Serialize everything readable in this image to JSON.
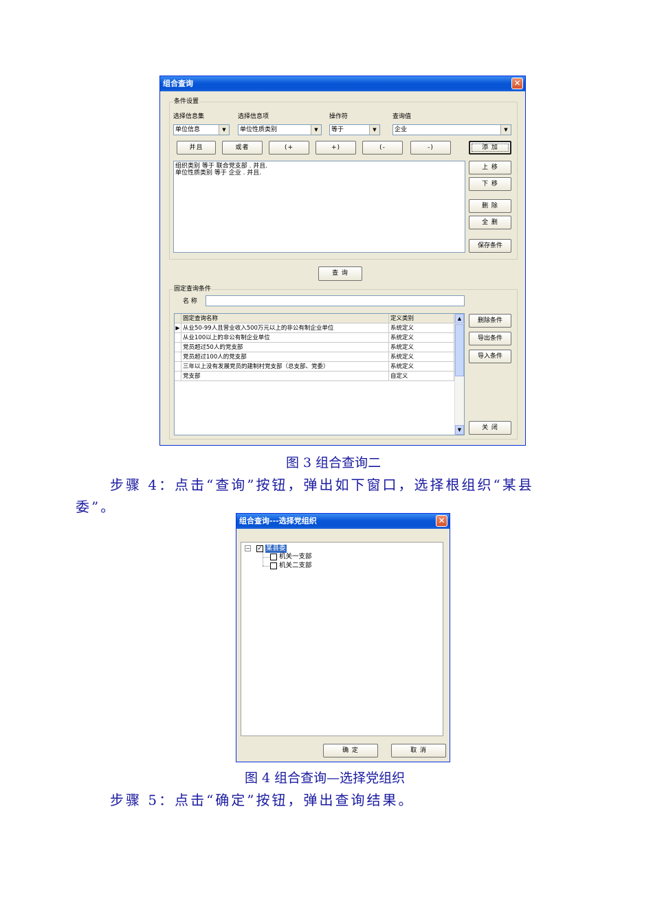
{
  "dialog1": {
    "title": "组合查询",
    "conditions_group": "条件设置",
    "col_labels": [
      "选择信息集",
      "选择信息项",
      "操作符",
      "查询值"
    ],
    "info_set": "单位信息",
    "info_item": "单位性质类别",
    "operator": "等于",
    "query_value": "企业",
    "logic_buttons": [
      "并且",
      "或者",
      "(+",
      "+)",
      "(-",
      "-)"
    ],
    "add_button": "添 加",
    "condition_lines": [
      "组织类别 等于 联合党支部 . 并且.",
      "单位性质类别 等于 企业 . 并且."
    ],
    "side_buttons": [
      "上 移",
      "下 移",
      "删 除",
      "全 删",
      "保存条件"
    ],
    "query_button": "查 询",
    "fixed_group": "固定查询条件",
    "name_label": "名 称",
    "name_value": "",
    "grid_headers": [
      "固定查询名称",
      "定义类别"
    ],
    "grid_rows": [
      [
        "从业50-99人且营业收入500万元以上的非公有制企业单位",
        "系统定义"
      ],
      [
        "从业100以上的非公有制企业单位",
        "系统定义"
      ],
      [
        "党员超过50人的党支部",
        "系统定义"
      ],
      [
        "党员超过100人的党支部",
        "系统定义"
      ],
      [
        "三年以上没有发展党员的建制村党支部（总支部、党委）",
        "系统定义"
      ],
      [
        "党支部",
        "自定义"
      ]
    ],
    "fixed_buttons": [
      "删除条件",
      "导出条件",
      "导入条件"
    ],
    "close_button": "关 闭"
  },
  "caption3": "图 3  组合查询二",
  "step4_line1": "步骤 4：点击“查询”按钮，弹出如下窗口，选择根组织“某县",
  "step4_line2": "委”。",
  "dialog2": {
    "title": "组合查询---选择党组织",
    "tree_root": "某县委",
    "tree_children": [
      "机关一支部",
      "机关二支部"
    ],
    "ok_button": "确 定",
    "cancel_button": "取 消"
  },
  "caption4": "图 4  组合查询—选择党组织",
  "step5": "步骤 5：点击“确定”按钮，弹出查询结果。"
}
